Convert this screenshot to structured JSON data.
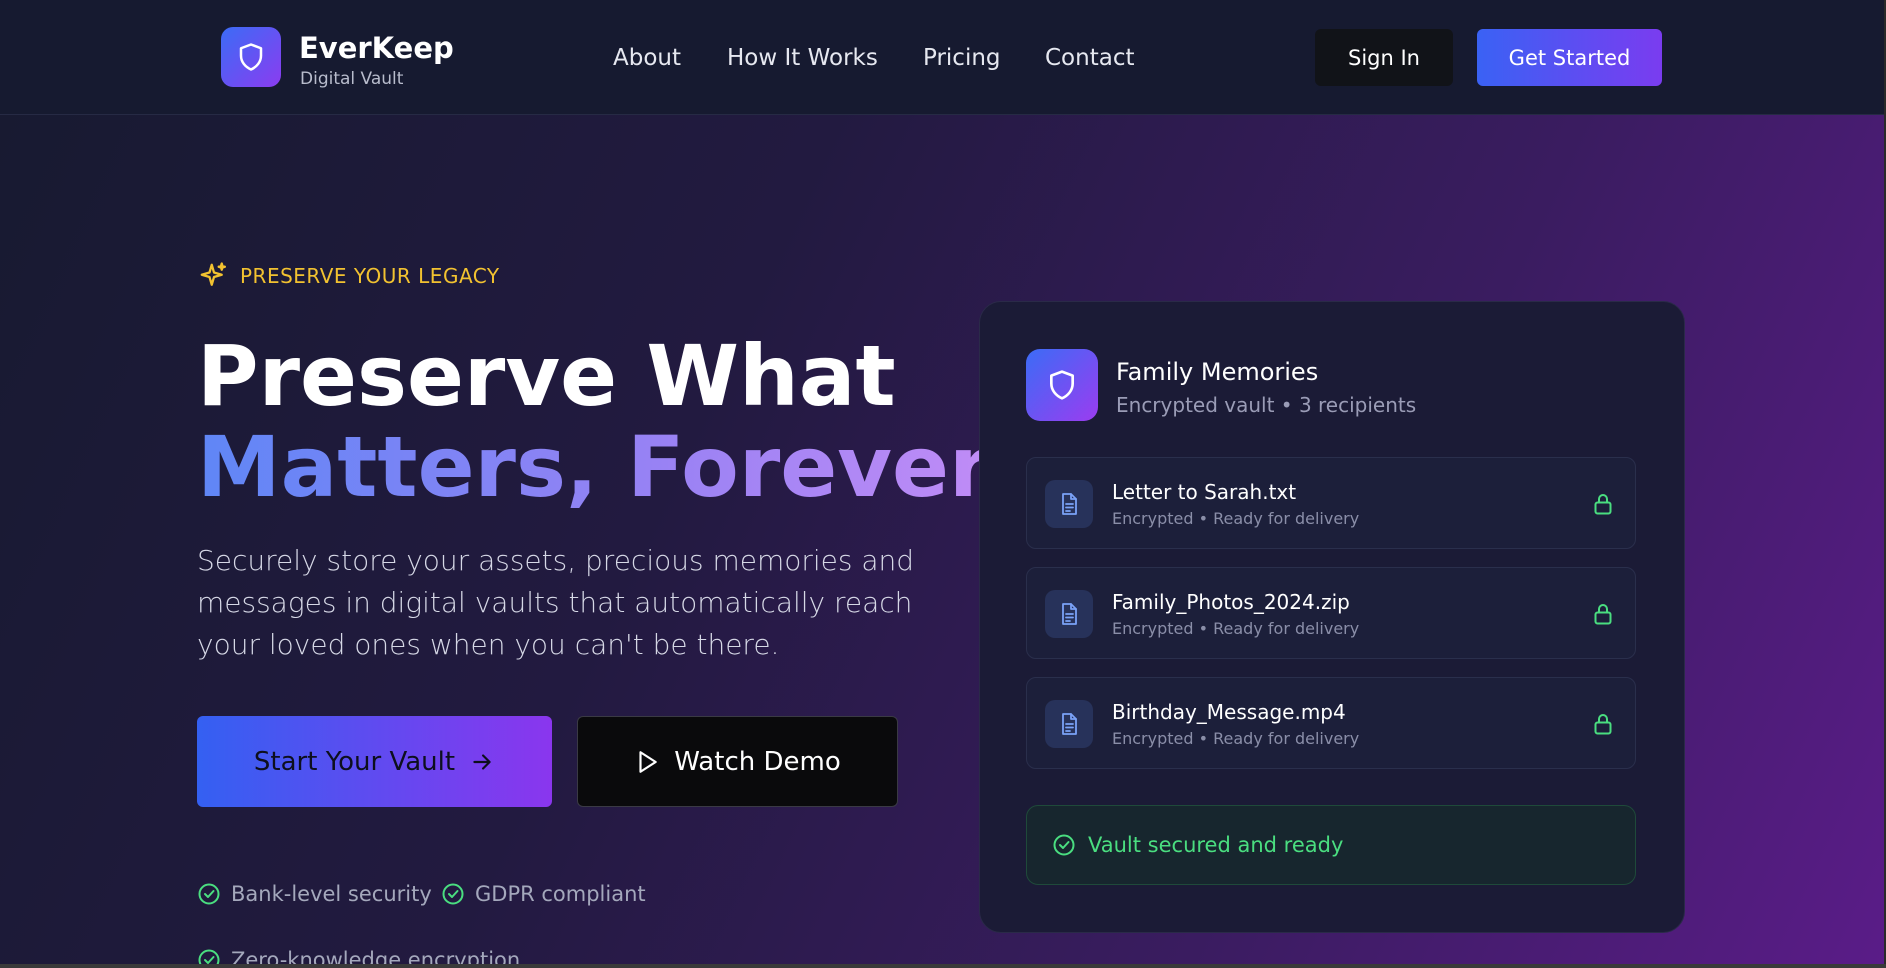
{
  "header": {
    "brand_name": "EverKeep",
    "brand_sub": "Digital Vault",
    "nav": [
      "About",
      "How It Works",
      "Pricing",
      "Contact"
    ],
    "signin_label": "Sign In",
    "get_started_label": "Get Started"
  },
  "hero": {
    "eyebrow": "PRESERVE YOUR LEGACY",
    "title_line1": "Preserve What",
    "title_line2": "Matters, Forever",
    "subtitle": "Securely store your assets, precious memories and messages in digital vaults that automatically reach your loved ones when you can't be there.",
    "start_label": "Start Your Vault",
    "demo_label": "Watch Demo",
    "features": [
      "Bank-level security",
      "GDPR compliant",
      "Zero-knowledge encryption"
    ]
  },
  "vault": {
    "title": "Family Memories",
    "subtitle": "Encrypted vault • 3 recipients",
    "files": [
      {
        "name": "Letter to Sarah.txt",
        "status": "Encrypted • Ready for delivery"
      },
      {
        "name": "Family_Photos_2024.zip",
        "status": "Encrypted • Ready for delivery"
      },
      {
        "name": "Birthday_Message.mp4",
        "status": "Encrypted • Ready for delivery"
      }
    ],
    "status": "Vault secured and ready"
  },
  "colors": {
    "accent_blue": "#3b6cf6",
    "accent_purple": "#8b3cf0",
    "eyebrow_gold": "#f2c230",
    "success_green": "#4ade80"
  },
  "icons": [
    "shield-icon",
    "sparkles-icon",
    "arrow-right-icon",
    "play-icon",
    "check-circle-icon",
    "file-text-icon",
    "lock-icon"
  ]
}
